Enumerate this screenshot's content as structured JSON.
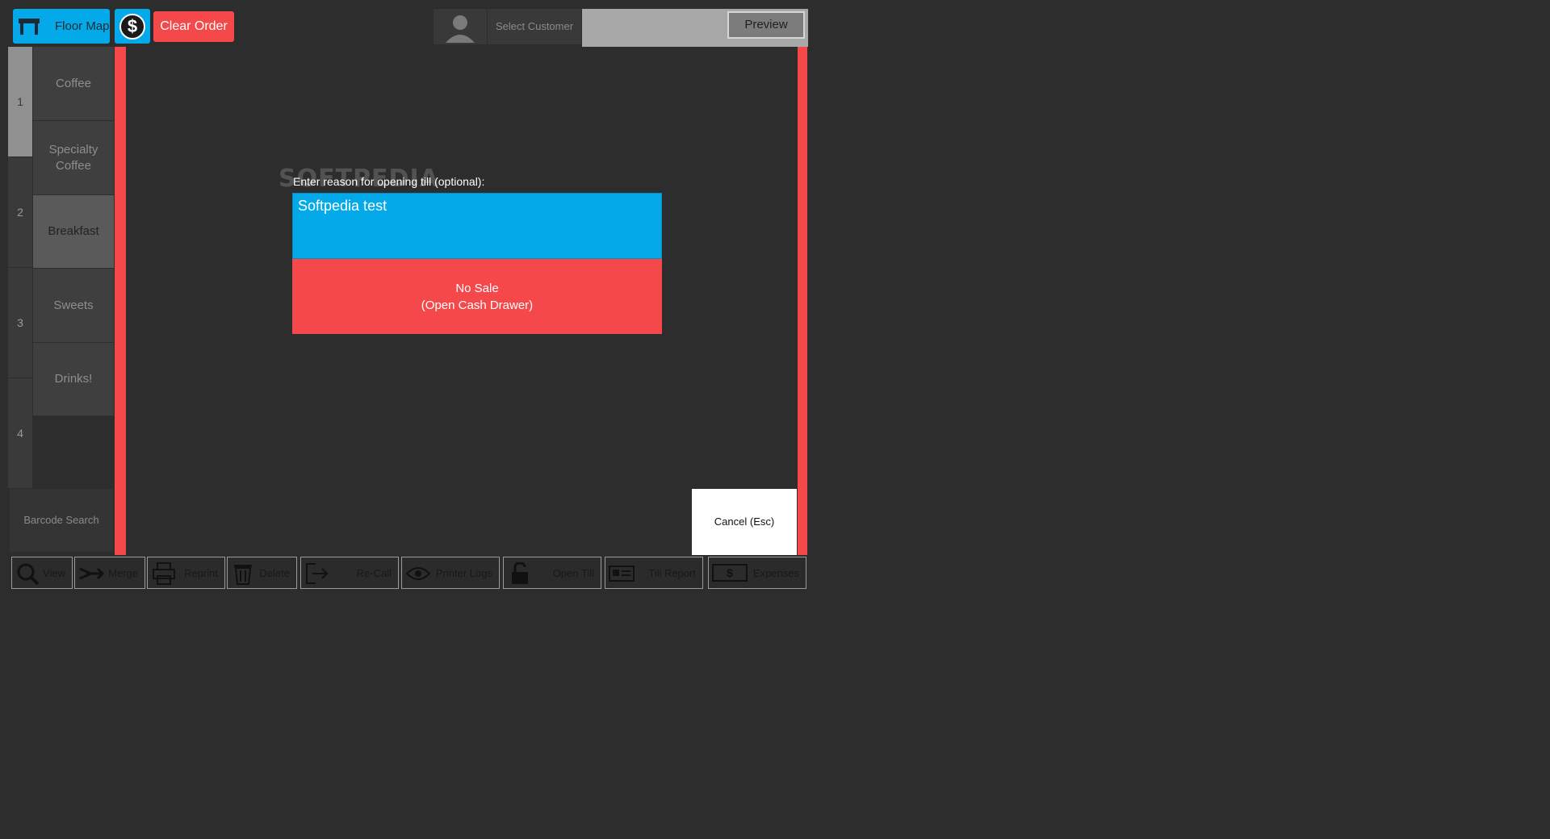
{
  "topbar": {
    "floor_map": "Floor Map",
    "clear_order": "Clear Order",
    "select_customer": "Select Customer",
    "preview": "Preview",
    "dollar_glyph": "$"
  },
  "pages": [
    "1",
    "2",
    "3",
    "4"
  ],
  "categories": [
    "Coffee",
    "Specialty Coffee",
    "Breakfast",
    "Sweets",
    "Drinks!"
  ],
  "barcode_search": "Barcode Search",
  "dialog": {
    "prompt": "Enter reason for opening till (optional):",
    "reason_value": "Softpedia test",
    "no_sale_line1": "No Sale",
    "no_sale_line2": "(Open Cash Drawer)",
    "watermark": "SOFTPEDIA"
  },
  "cancel": "Cancel (Esc)",
  "toolbar": {
    "view": "View",
    "merge": "Merge",
    "reprint": "Reprint",
    "delete": "Delete",
    "recall": "Re-Call",
    "printer_logs": "Printer Logs",
    "open_till": "Open Till",
    "till_report": "Till Report",
    "expenses": "Expenses",
    "expenses_glyph": "$"
  },
  "colors": {
    "accent_blue": "#03a9e8",
    "accent_red": "#f4484b",
    "background": "#2d2d2d"
  }
}
